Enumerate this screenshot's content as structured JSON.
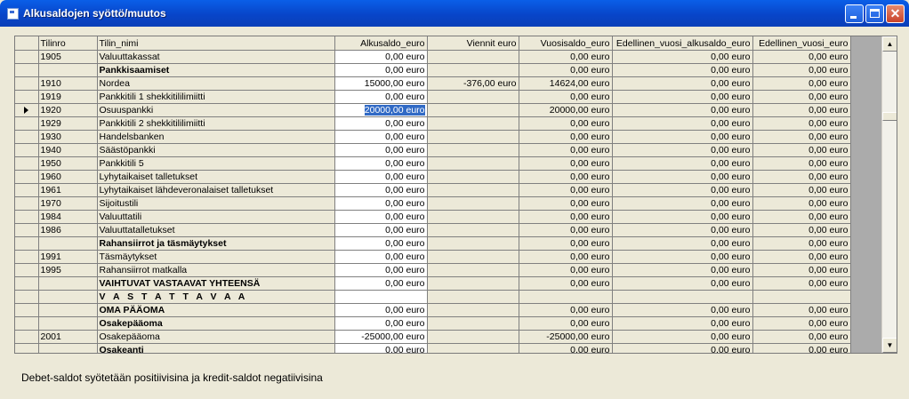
{
  "window": {
    "title": "Alkusaldojen syöttö/muutos",
    "icon": "app-icon"
  },
  "grid": {
    "columns": [
      "Tilinro",
      "Tilin_nimi",
      "Alkusaldo_euro",
      "Viennit euro",
      "Vuosisaldo_euro",
      "Edellinen_vuosi_alkusaldo_euro",
      "Edellinen_vuosi_euro"
    ],
    "rows": [
      {
        "nr": "1905",
        "name": "Valuuttakassat",
        "alku": "0,00 euro",
        "viennit": "",
        "vuosi": "0,00 euro",
        "ed_alku": "0,00 euro",
        "ed": "0,00 euro"
      },
      {
        "nr": "",
        "name": "Pankkisaamiset",
        "bold": true,
        "alku": "0,00 euro",
        "viennit": "",
        "vuosi": "0,00 euro",
        "ed_alku": "0,00 euro",
        "ed": "0,00 euro"
      },
      {
        "nr": "1910",
        "name": "Nordea",
        "alku": "15000,00 euro",
        "viennit": "-376,00 euro",
        "vuosi": "14624,00 euro",
        "ed_alku": "0,00 euro",
        "ed": "0,00 euro"
      },
      {
        "nr": "1919",
        "name": "Pankkitili 1 shekkitililimiitti",
        "alku": "0,00 euro",
        "viennit": "",
        "vuosi": "0,00 euro",
        "ed_alku": "0,00 euro",
        "ed": "0,00 euro"
      },
      {
        "nr": "1920",
        "name": "Osuuspankki",
        "current": true,
        "alku": "20000,00 euro",
        "viennit": "",
        "vuosi": "20000,00 euro",
        "ed_alku": "0,00 euro",
        "ed": "0,00 euro"
      },
      {
        "nr": "1929",
        "name": "Pankkitili 2 shekkitililimiitti",
        "alku": "0,00 euro",
        "viennit": "",
        "vuosi": "0,00 euro",
        "ed_alku": "0,00 euro",
        "ed": "0,00 euro"
      },
      {
        "nr": "1930",
        "name": "Handelsbanken",
        "alku": "0,00 euro",
        "viennit": "",
        "vuosi": "0,00 euro",
        "ed_alku": "0,00 euro",
        "ed": "0,00 euro"
      },
      {
        "nr": "1940",
        "name": "Säästöpankki",
        "alku": "0,00 euro",
        "viennit": "",
        "vuosi": "0,00 euro",
        "ed_alku": "0,00 euro",
        "ed": "0,00 euro"
      },
      {
        "nr": "1950",
        "name": "Pankkitili 5",
        "alku": "0,00 euro",
        "viennit": "",
        "vuosi": "0,00 euro",
        "ed_alku": "0,00 euro",
        "ed": "0,00 euro"
      },
      {
        "nr": "1960",
        "name": "Lyhytaikaiset talletukset",
        "alku": "0,00 euro",
        "viennit": "",
        "vuosi": "0,00 euro",
        "ed_alku": "0,00 euro",
        "ed": "0,00 euro"
      },
      {
        "nr": "1961",
        "name": "Lyhytaikaiset lähdeveronalaiset talletukset",
        "alku": "0,00 euro",
        "viennit": "",
        "vuosi": "0,00 euro",
        "ed_alku": "0,00 euro",
        "ed": "0,00 euro"
      },
      {
        "nr": "1970",
        "name": "Sijoitustili",
        "alku": "0,00 euro",
        "viennit": "",
        "vuosi": "0,00 euro",
        "ed_alku": "0,00 euro",
        "ed": "0,00 euro"
      },
      {
        "nr": "1984",
        "name": "Valuuttatili",
        "alku": "0,00 euro",
        "viennit": "",
        "vuosi": "0,00 euro",
        "ed_alku": "0,00 euro",
        "ed": "0,00 euro"
      },
      {
        "nr": "1986",
        "name": "Valuuttatalletukset",
        "alku": "0,00 euro",
        "viennit": "",
        "vuosi": "0,00 euro",
        "ed_alku": "0,00 euro",
        "ed": "0,00 euro"
      },
      {
        "nr": "",
        "name": "Rahansiirrot ja täsmäytykset",
        "bold": true,
        "alku": "0,00 euro",
        "viennit": "",
        "vuosi": "0,00 euro",
        "ed_alku": "0,00 euro",
        "ed": "0,00 euro"
      },
      {
        "nr": "1991",
        "name": "Täsmäytykset",
        "alku": "0,00 euro",
        "viennit": "",
        "vuosi": "0,00 euro",
        "ed_alku": "0,00 euro",
        "ed": "0,00 euro"
      },
      {
        "nr": "1995",
        "name": "Rahansiirrot matkalla",
        "alku": "0,00 euro",
        "viennit": "",
        "vuosi": "0,00 euro",
        "ed_alku": "0,00 euro",
        "ed": "0,00 euro"
      },
      {
        "nr": "",
        "name": "VAIHTUVAT VASTAAVAT YHTEENSÄ",
        "bold": true,
        "alku": "0,00 euro",
        "viennit": "",
        "vuosi": "0,00 euro",
        "ed_alku": "0,00 euro",
        "ed": "0,00 euro"
      },
      {
        "nr": "",
        "name": "V A S T A T T A V A A",
        "bold": true,
        "alku": "",
        "viennit": "",
        "vuosi": "",
        "ed_alku": "",
        "ed": ""
      },
      {
        "nr": "",
        "name": "OMA PÄÄOMA",
        "bold": true,
        "alku": "0,00 euro",
        "viennit": "",
        "vuosi": "0,00 euro",
        "ed_alku": "0,00 euro",
        "ed": "0,00 euro"
      },
      {
        "nr": "",
        "name": "Osakepääoma",
        "bold": true,
        "alku": "0,00 euro",
        "viennit": "",
        "vuosi": "0,00 euro",
        "ed_alku": "0,00 euro",
        "ed": "0,00 euro"
      },
      {
        "nr": "2001",
        "name": "Osakepääoma",
        "alku": "-25000,00 euro",
        "viennit": "",
        "vuosi": "-25000,00 euro",
        "ed_alku": "0,00 euro",
        "ed": "0,00 euro"
      },
      {
        "nr": "",
        "name": "Osakeanti",
        "bold": true,
        "alku": "0,00 euro",
        "viennit": "",
        "vuosi": "0,00 euro",
        "ed_alku": "0,00 euro",
        "ed": "0,00 euro"
      }
    ]
  },
  "footer": {
    "hint": "Debet-saldot syötetään positiivisina ja kredit-saldot negatiivisina"
  }
}
